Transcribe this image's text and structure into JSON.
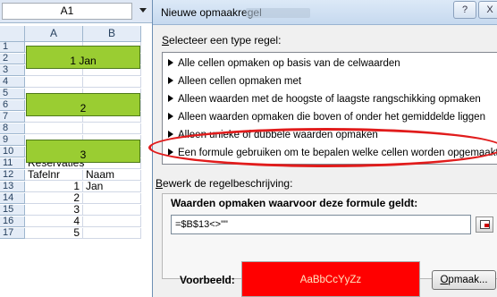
{
  "spreadsheet": {
    "name_box": "A1",
    "columns": [
      "A",
      "B"
    ],
    "rows": [
      {
        "num": "1",
        "a": "",
        "b": ""
      },
      {
        "num": "2",
        "a": "",
        "b": ""
      },
      {
        "num": "3",
        "a": "",
        "b": ""
      },
      {
        "num": "4",
        "a": "",
        "b": ""
      },
      {
        "num": "5",
        "a": "",
        "b": ""
      },
      {
        "num": "6",
        "a": "",
        "b": ""
      },
      {
        "num": "7",
        "a": "",
        "b": ""
      },
      {
        "num": "8",
        "a": "",
        "b": ""
      },
      {
        "num": "9",
        "a": "",
        "b": ""
      },
      {
        "num": "10",
        "a": "",
        "b": ""
      },
      {
        "num": "11",
        "a": "Reservaties",
        "b": ""
      },
      {
        "num": "12",
        "a": "Tafelnr",
        "b": "Naam"
      },
      {
        "num": "13",
        "a": "1",
        "b": "Jan"
      },
      {
        "num": "14",
        "a": "2",
        "b": ""
      },
      {
        "num": "15",
        "a": "3",
        "b": ""
      },
      {
        "num": "16",
        "a": "4",
        "b": ""
      },
      {
        "num": "17",
        "a": "5",
        "b": ""
      }
    ],
    "highlighted_blocks": [
      "1 Jan",
      "2",
      "3"
    ],
    "highlight_color": "#9acd32"
  },
  "dialog": {
    "title": "Nieuwe opmaakregel",
    "help_button": "?",
    "close_button": "X",
    "select_type_label_key": "S",
    "select_type_label_rest": "electeer een type regel:",
    "rule_types": [
      "Alle cellen opmaken op basis van de celwaarden",
      "Alleen cellen opmaken met",
      "Alleen waarden met de hoogste of laagste rangschikking opmaken",
      "Alleen waarden opmaken die boven of onder het gemiddelde liggen",
      "Alleen unieke of dubbele waarden opmaken",
      "Een formule gebruiken om te bepalen welke cellen worden opgemaakt"
    ],
    "selected_rule_index": 5,
    "highlight_color": "#e11c1c",
    "edit_label_key": "B",
    "edit_label_rest": "ewerk de regelbeschrijving:",
    "formula_header": "Waarden opmaken waarvoor deze formule geldt:",
    "formula_value": "=$B$13<>\"\"",
    "preview_label": "Voorbeeld:",
    "preview_text": "AaBbCcYyZz",
    "preview_color": "#ff0000",
    "format_button_key": "O",
    "format_button_rest": "pmaak..."
  }
}
